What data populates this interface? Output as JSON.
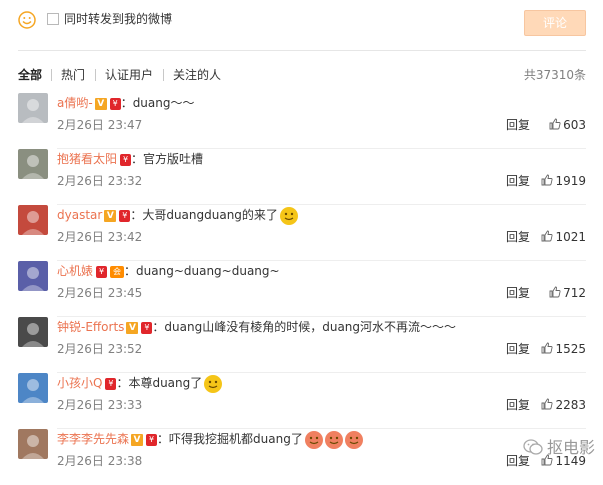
{
  "composer": {
    "emoji_icon": "smiley-face-icon",
    "repost_label": "同时转发到我的微博",
    "submit_label": "评论"
  },
  "filters": {
    "items": [
      "全部",
      "热门",
      "认证用户",
      "关注的人"
    ],
    "active": "全部",
    "total": "共37310条"
  },
  "comments": [
    {
      "name": "a倩哟-",
      "badges": [
        "V",
        "red"
      ],
      "text": "：duang～～",
      "emojis": 0,
      "time": "2月26日 23:47",
      "reply": "回复",
      "likes": "603",
      "avatar_color": "#b8bcc0"
    },
    {
      "name": "抱猪看太阳",
      "badges": [
        "red"
      ],
      "text": "：官方版吐槽",
      "emojis": 0,
      "time": "2月26日 23:32",
      "reply": "回复",
      "likes": "1919",
      "avatar_color": "#8a8f80"
    },
    {
      "name": "dyastar",
      "badges": [
        "V",
        "red"
      ],
      "text": "：大哥duangduang的来了",
      "emojis": 1,
      "time": "2月26日 23:42",
      "reply": "回复",
      "likes": "1021",
      "avatar_color": "#c44a3d"
    },
    {
      "name": "心机婊",
      "badges": [
        "red",
        "member"
      ],
      "text": "：duang~duang~duang~",
      "emojis": 0,
      "time": "2月26日 23:45",
      "reply": "回复",
      "likes": "712",
      "avatar_color": "#5a5fa8"
    },
    {
      "name": "钟锐-Efforts",
      "badges": [
        "V",
        "red"
      ],
      "text": "：duang山峰没有棱角的时候，duang河水不再流～～～",
      "emojis": 0,
      "time": "2月26日 23:52",
      "reply": "回复",
      "likes": "1525",
      "avatar_color": "#4a4a4a"
    },
    {
      "name": "小孩小Q",
      "badges": [
        "red"
      ],
      "text": "：本尊duang了",
      "emojis": 1,
      "time": "2月26日 23:33",
      "reply": "回复",
      "likes": "2283",
      "avatar_color": "#4d86c6"
    },
    {
      "name": "李李李先先森",
      "badges": [
        "V",
        "red"
      ],
      "text": "：吓得我挖掘机都duang了",
      "emojis": 3,
      "emoji_style": "red",
      "time": "2月26日 23:38",
      "reply": "回复",
      "likes": "1149",
      "avatar_color": "#a07860"
    }
  ],
  "watermark": {
    "icon": "wechat-icon",
    "text": "抠电影"
  },
  "colors": {
    "accent": "#eb7350",
    "submit_bg": "#ffd9b8",
    "vip": "#f5a623",
    "red_badge": "#e0262b"
  }
}
